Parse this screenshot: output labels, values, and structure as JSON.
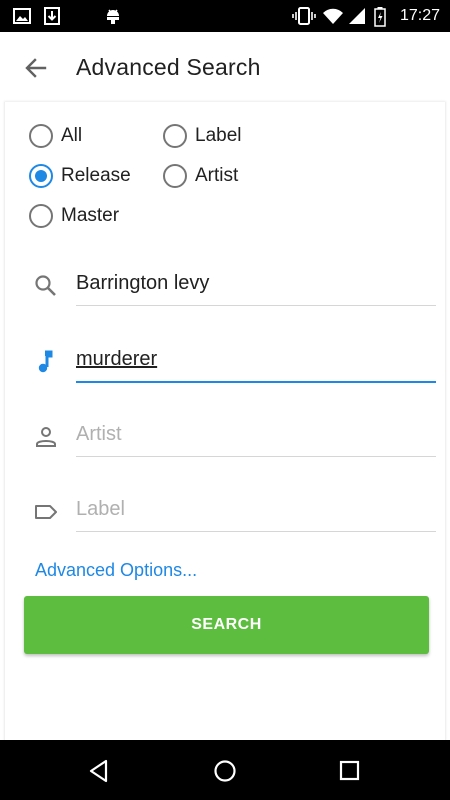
{
  "status_bar": {
    "time": "17:27",
    "icons": [
      "image-icon",
      "download-icon",
      "android-icon",
      "vibrate-icon",
      "wifi-icon",
      "cell-signal-icon",
      "battery-icon"
    ]
  },
  "app_bar": {
    "title": "Advanced Search",
    "back_icon": "arrow-back-icon"
  },
  "search_type": {
    "options": [
      {
        "label": "All",
        "checked": false
      },
      {
        "label": "Label",
        "checked": false
      },
      {
        "label": "Release",
        "checked": true
      },
      {
        "label": "Artist",
        "checked": false
      },
      {
        "label": "Master",
        "checked": false
      }
    ]
  },
  "fields": {
    "query": {
      "value": "Barrington levy",
      "placeholder": "",
      "icon": "search-icon"
    },
    "track": {
      "value": "murderer",
      "placeholder": "",
      "icon": "music-note-icon"
    },
    "artist": {
      "value": "",
      "placeholder": "Artist",
      "icon": "person-icon"
    },
    "label": {
      "value": "",
      "placeholder": "Label",
      "icon": "label-tag-icon"
    }
  },
  "advanced_options_link": "Advanced Options...",
  "search_button": "SEARCH",
  "colors": {
    "accent": "#1e88e5",
    "search_button": "#5cbd3e",
    "icon_gray": "#757575"
  },
  "nav_bar": {
    "icons": [
      "nav-back-icon",
      "nav-home-icon",
      "nav-recents-icon"
    ]
  }
}
